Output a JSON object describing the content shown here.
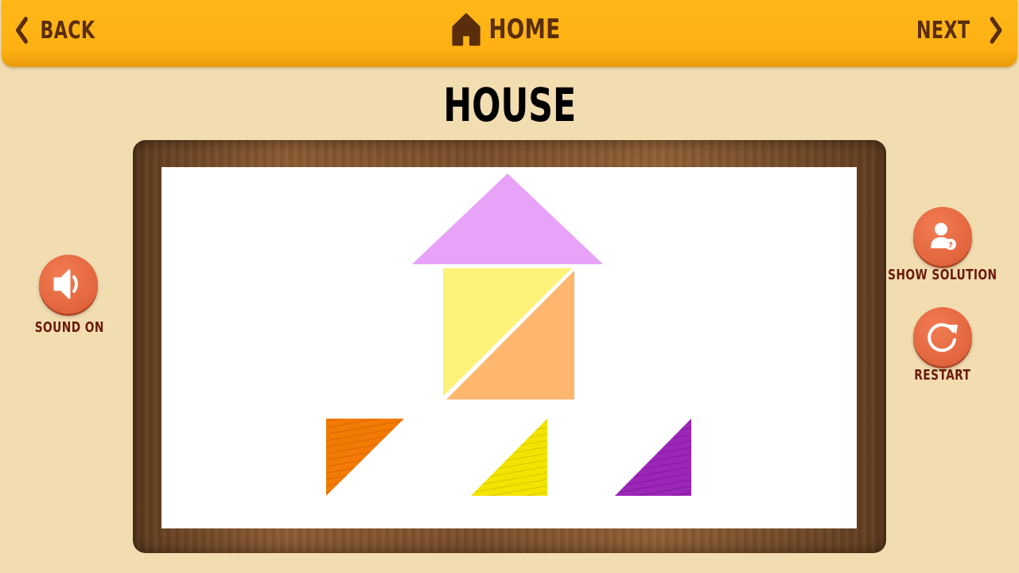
{
  "topbar": {
    "back_label": "BACK",
    "home_label": "HOME",
    "next_label": "NEXT"
  },
  "puzzle": {
    "title": "HOUSE"
  },
  "controls": {
    "sound_label": "SOUND ON",
    "show_solution_label": "SHOW SOLUTION",
    "restart_label": "RESTART"
  },
  "icons": {
    "back": "chevron-left-icon",
    "home": "home-icon",
    "next": "chevron-right-icon",
    "sound": "speaker-icon",
    "solution": "user-question-icon",
    "restart": "refresh-icon"
  },
  "colors": {
    "topbar": "#ffb012",
    "background": "#f2ddb1",
    "nav_text": "#5a2d0c",
    "button": "#e2653d",
    "button_label": "#6b1a0a",
    "roof_piece": "#e8a2f8",
    "yellow_piece": "#fef37a",
    "peach_piece": "#ffb770",
    "orange_piece": "#f27a05",
    "lemon_piece": "#f3e400",
    "purple_piece": "#9b26b8"
  }
}
